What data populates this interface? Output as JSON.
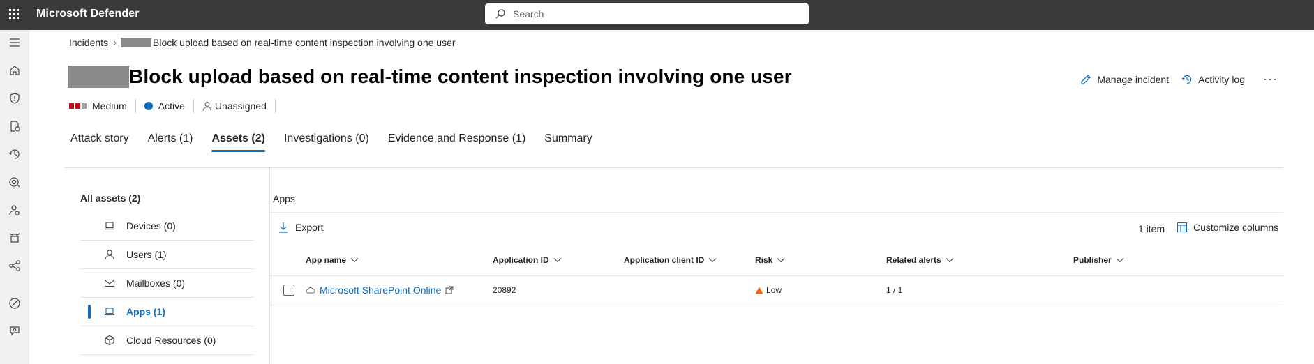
{
  "app": {
    "title": "Microsoft Defender"
  },
  "search": {
    "placeholder": "Search"
  },
  "rail": {
    "icons": [
      "menu-icon",
      "home-icon",
      "shield-icon",
      "incidents-icon",
      "hunting-icon",
      "actions-icon",
      "identity-icon",
      "partners-icon",
      "graph-icon",
      "secure-score-icon",
      "community-icon"
    ]
  },
  "breadcrumb": {
    "parent": "Incidents",
    "current": "Block upload based on real-time content inspection involving one user"
  },
  "page": {
    "title": "Block upload based on real-time content inspection involving one user"
  },
  "header_actions": {
    "manage": "Manage incident",
    "activity": "Activity log",
    "more": "···"
  },
  "status": {
    "severity": "Medium",
    "severity_colors": [
      "#c50f1f",
      "#c50f1f",
      "#a19f9d"
    ],
    "state": "Active",
    "state_color": "#0f6cbd",
    "assignee": "Unassigned"
  },
  "tabs": [
    {
      "label": "Attack story",
      "active": false
    },
    {
      "label": "Alerts (1)",
      "active": false
    },
    {
      "label": "Assets (2)",
      "active": true
    },
    {
      "label": "Investigations (0)",
      "active": false
    },
    {
      "label": "Evidence and Response (1)",
      "active": false
    },
    {
      "label": "Summary",
      "active": false
    }
  ],
  "assets": {
    "heading": "All assets (2)",
    "items": [
      {
        "label": "Devices (0)",
        "icon": "laptop-icon",
        "active": false
      },
      {
        "label": "Users (1)",
        "icon": "person-icon",
        "active": false
      },
      {
        "label": "Mailboxes (0)",
        "icon": "mail-icon",
        "active": false
      },
      {
        "label": "Apps (1)",
        "icon": "app-icon",
        "active": true
      },
      {
        "label": "Cloud Resources (0)",
        "icon": "cube-icon",
        "active": false
      }
    ]
  },
  "apps_panel": {
    "section_title": "Apps",
    "export_label": "Export",
    "count_label": "1 item",
    "customize_label": "Customize columns",
    "columns": [
      "App name",
      "Application ID",
      "Application client ID",
      "Risk",
      "Related alerts",
      "Publisher"
    ],
    "rows": [
      {
        "app_name": "Microsoft SharePoint Online",
        "application_id": "20892",
        "application_client_id": "",
        "risk": "Low",
        "risk_color": "#f7630c",
        "related_alerts": "1 / 1",
        "publisher": ""
      }
    ]
  },
  "colors": {
    "accent": "#0f6cbd",
    "topbar": "#3b3a39",
    "rail": "#f0f0f0"
  }
}
